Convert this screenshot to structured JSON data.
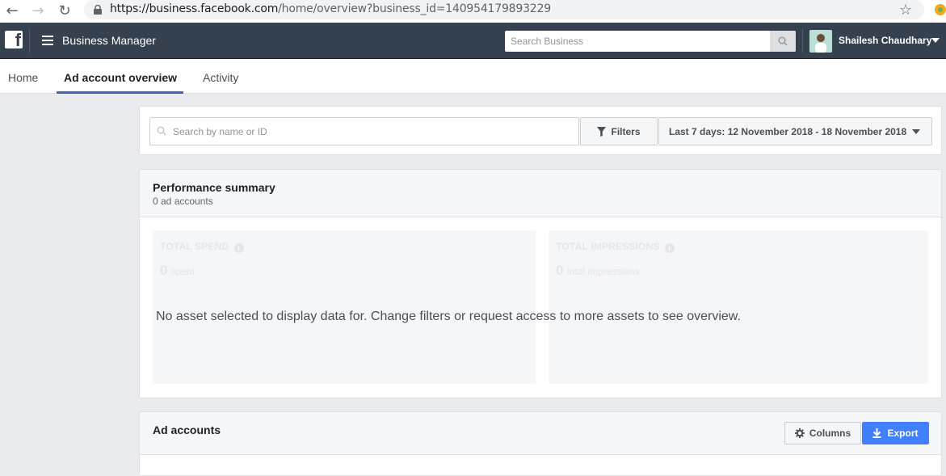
{
  "browser": {
    "url_host": "https://business.facebook.com",
    "url_path": "/home/overview?business_id=140954179893229"
  },
  "topbar": {
    "logo_letter": "f",
    "title": "Business Manager",
    "search_placeholder": "Search Business",
    "user_name": "Shailesh Chaudhary"
  },
  "tabs": [
    {
      "label": "Home"
    },
    {
      "label": "Ad account overview",
      "active": true
    },
    {
      "label": "Activity"
    }
  ],
  "filters": {
    "search_placeholder": "Search by name or ID",
    "filters_label": "Filters",
    "date_range_label": "Last 7 days: 12 November 2018 - 18 November 2018"
  },
  "performance": {
    "title": "Performance summary",
    "subtitle": "0 ad accounts",
    "metrics": [
      {
        "label": "TOTAL SPEND",
        "value": "0",
        "unit": "spent"
      },
      {
        "label": "TOTAL IMPRESSIONS",
        "value": "0",
        "unit": "total impressions"
      }
    ],
    "empty_message": "No asset selected to display data for. Change filters or request access to more assets to see overview."
  },
  "ad_accounts": {
    "title": "Ad accounts",
    "columns_label": "Columns",
    "export_label": "Export"
  },
  "colors": {
    "topbar": "#364150",
    "accent": "#4267b2",
    "export": "#4080ff"
  }
}
